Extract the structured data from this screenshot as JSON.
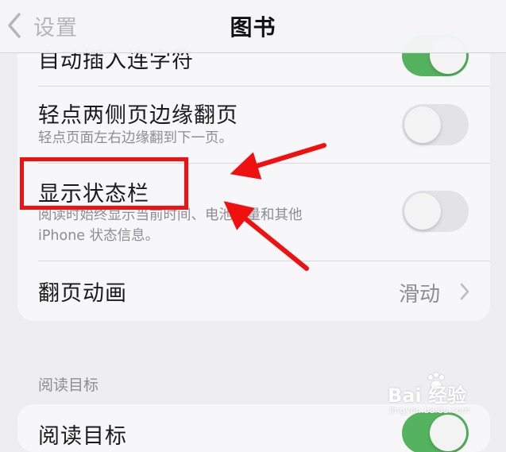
{
  "nav": {
    "back_label": "设置",
    "title": "图书"
  },
  "settings": {
    "auto_hyphen": {
      "title": "自动插入连字符",
      "enabled": true
    },
    "tap_edges": {
      "title": "轻点两侧页边缘翻页",
      "subtitle": "轻点页面左右边缘翻到下一页。",
      "enabled": false
    },
    "show_status_bar": {
      "title": "显示状态栏",
      "subtitle_line1": "阅读时始终显示当前时间、电池电量和其他",
      "subtitle_line2": "iPhone 状态信息。",
      "enabled": false
    },
    "page_turn": {
      "title": "翻页动画",
      "value": "滑动"
    }
  },
  "reading_goals": {
    "header": "阅读目标",
    "row_title": "阅读目标",
    "enabled": true
  },
  "watermark": {
    "line1": "Bai 经验",
    "line2": "jingyan.baidu.com"
  },
  "colors": {
    "toggle_on": "#55b25e",
    "toggle_off": "#e3e3e6",
    "annotation": "#f01010"
  },
  "icons": {
    "back": "chevron-left-icon",
    "disclosure": "chevron-right-icon",
    "watermark_logo": "paw-icon"
  }
}
